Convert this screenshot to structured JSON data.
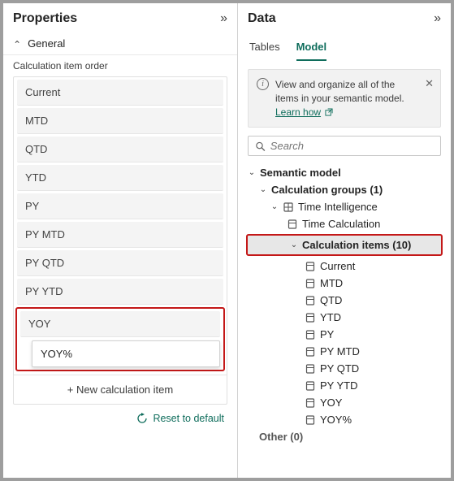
{
  "properties": {
    "title": "Properties",
    "general_label": "General",
    "order_title": "Calculation item order",
    "items": [
      "Current",
      "MTD",
      "QTD",
      "YTD",
      "PY",
      "PY MTD",
      "PY QTD",
      "PY YTD",
      "YOY"
    ],
    "editing_item": "YOY%",
    "new_label": "+ New calculation item",
    "reset_label": "Reset to default"
  },
  "data": {
    "title": "Data",
    "tabs": {
      "tables": "Tables",
      "model": "Model"
    },
    "banner": {
      "text": "View and organize all of the items in your semantic model. ",
      "link": "Learn how"
    },
    "search_placeholder": "Search",
    "tree": {
      "root": "Semantic model",
      "calc_groups": "Calculation groups (1)",
      "time_intel": "Time Intelligence",
      "time_calc": "Time Calculation",
      "calc_items": "Calculation items (10)",
      "items": [
        "Current",
        "MTD",
        "QTD",
        "YTD",
        "PY",
        "PY MTD",
        "PY QTD",
        "PY YTD",
        "YOY",
        "YOY%"
      ],
      "other": "Other (0)"
    }
  }
}
